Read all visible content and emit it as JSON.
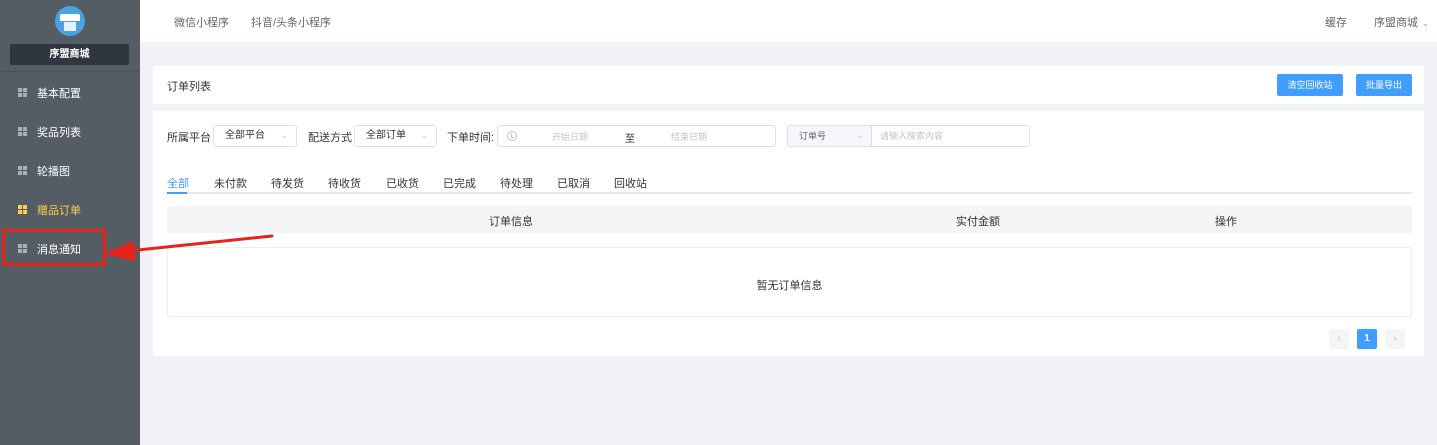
{
  "sidebar": {
    "brand_name": "序盟商城",
    "items": [
      {
        "label": "基本配置",
        "active": false
      },
      {
        "label": "奖品列表",
        "active": false
      },
      {
        "label": "轮播图",
        "active": false
      },
      {
        "label": "赠品订单",
        "active": true
      },
      {
        "label": "消息通知",
        "active": false
      }
    ]
  },
  "topbar": {
    "tabs": [
      "微信小程序",
      "抖音/头条小程序"
    ],
    "cache": "缓存",
    "user": "序盟商城"
  },
  "header": {
    "title": "订单列表",
    "clear_recycle": "清空回收站",
    "batch_export": "批量导出"
  },
  "filters": {
    "platform_label": "所属平台",
    "platform_value": "全部平台",
    "delivery_label": "配送方式",
    "delivery_value": "全部订单",
    "time_label": "下单时间:",
    "start_placeholder": "开始日期",
    "separator": "至",
    "end_placeholder": "结束日期",
    "search_type": "订单号",
    "search_placeholder": "请输入搜索内容"
  },
  "tabs": [
    "全部",
    "未付款",
    "待发货",
    "待收货",
    "已收货",
    "已完成",
    "待处理",
    "已取消",
    "回收站"
  ],
  "table": {
    "columns": [
      "订单信息",
      "实付金额",
      "操作"
    ],
    "empty": "暂无订单信息"
  },
  "pagination": {
    "current": "1",
    "prev": "‹",
    "next": "›"
  },
  "colors": {
    "accent": "#409eff",
    "sidebar_bg": "#545c64",
    "active_menu": "#ffd04b",
    "annotation": "#e8231c"
  }
}
